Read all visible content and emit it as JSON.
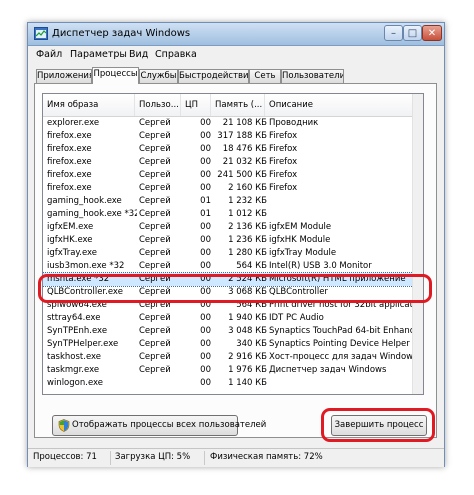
{
  "window": {
    "title": "Диспетчер задач Windows"
  },
  "menu": [
    "Файл",
    "Параметры",
    "Вид",
    "Справка"
  ],
  "tabs": [
    {
      "label": "Приложения",
      "active": false
    },
    {
      "label": "Процессы",
      "active": true
    },
    {
      "label": "Службы",
      "active": false
    },
    {
      "label": "Быстродействие",
      "active": false
    },
    {
      "label": "Сеть",
      "active": false
    },
    {
      "label": "Пользователи",
      "active": false
    }
  ],
  "columns": [
    "Имя образа",
    "Пользо...",
    "ЦП",
    "Память (...",
    "Описание"
  ],
  "rows": [
    [
      "explorer.exe",
      "Сергей",
      "00",
      "21 108 КБ",
      "Проводник"
    ],
    [
      "firefox.exe",
      "Сергей",
      "00",
      "317 188 КБ",
      "Firefox"
    ],
    [
      "firefox.exe",
      "Сергей",
      "00",
      "18 476 КБ",
      "Firefox"
    ],
    [
      "firefox.exe",
      "Сергей",
      "00",
      "21 032 КБ",
      "Firefox"
    ],
    [
      "firefox.exe",
      "Сергей",
      "00",
      "241 500 КБ",
      "Firefox"
    ],
    [
      "firefox.exe",
      "Сергей",
      "00",
      "2 160 КБ",
      "Firefox"
    ],
    [
      "gaming_hook.exe",
      "Сергей",
      "01",
      "1 232 КБ",
      ""
    ],
    [
      "gaming_hook.exe *32",
      "Сергей",
      "01",
      "1 012 КБ",
      ""
    ],
    [
      "igfxEM.exe",
      "Сергей",
      "00",
      "2 136 КБ",
      "igfxEM Module"
    ],
    [
      "igfxHK.exe",
      "Сергей",
      "00",
      "1 236 КБ",
      "igfxHK Module"
    ],
    [
      "igfxTray.exe",
      "Сергей",
      "00",
      "1 280 КБ",
      "igfxTray Module"
    ],
    [
      "iusb3mon.exe *32",
      "Сергей",
      "00",
      "564 КБ",
      "Intel(R) USB 3.0 Monitor"
    ],
    [
      "mshta.exe *32",
      "Сергей",
      "00",
      "2 524 КБ",
      "Microsoft(R) HTML приложение"
    ],
    [
      "QLBController.exe",
      "Сергей",
      "00",
      "3 068 КБ",
      "QLBController"
    ],
    [
      "splwow64.exe",
      "Сергей",
      "00",
      "564 КБ",
      "Print driver host for 32bit applications"
    ],
    [
      "sttray64.exe",
      "Сергей",
      "00",
      "1 940 КБ",
      "IDT PC Audio"
    ],
    [
      "SynTPEnh.exe",
      "Сергей",
      "00",
      "3 048 КБ",
      "Synaptics TouchPad 64-bit Enhancements"
    ],
    [
      "SynTPHelper.exe",
      "Сергей",
      "00",
      "340 КБ",
      "Synaptics Pointing Device Helper"
    ],
    [
      "taskhost.exe",
      "Сергей",
      "00",
      "2 916 КБ",
      "Хост-процесс для задач Windows"
    ],
    [
      "taskmgr.exe",
      "Сергей",
      "00",
      "1 976 КБ",
      "Диспетчер задач Windows"
    ],
    [
      "winlogon.exe",
      "",
      "00",
      "1 140 КБ",
      ""
    ]
  ],
  "selected_row": "mshta.exe *32",
  "buttons": {
    "show_all": "Отображать процессы всех пользователей",
    "end_process": "Завершить процесс"
  },
  "status": {
    "processes": "Процессов: 71",
    "cpu": "Загрузка ЦП: 5%",
    "memory": "Физическая память: 72%"
  },
  "colors": {
    "highlight": "#e01a22",
    "selection": "#cde8ff"
  },
  "icons": [
    "app-icon",
    "minimize-icon",
    "maximize-icon",
    "close-icon",
    "shield-icon"
  ]
}
